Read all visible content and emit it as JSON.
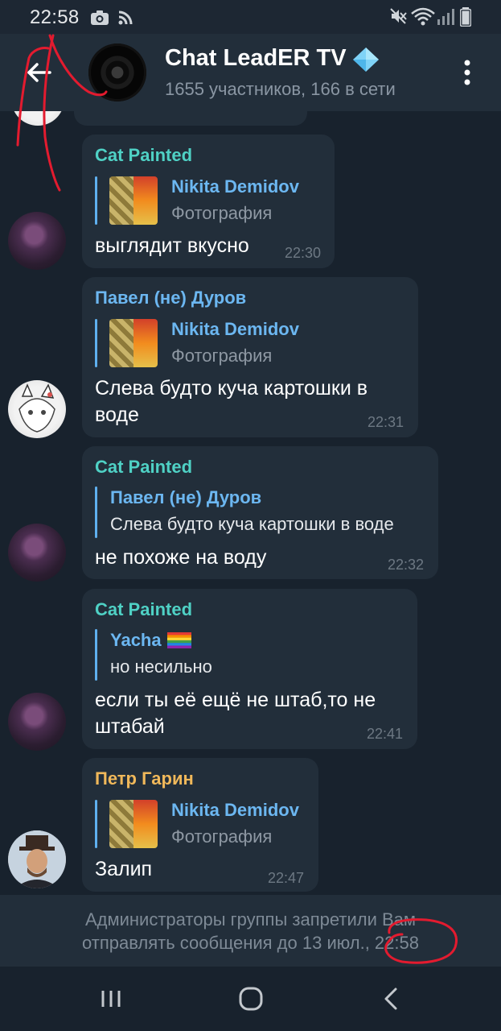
{
  "status_bar": {
    "time": "22:58"
  },
  "header": {
    "title": "Chat LeadER TV",
    "subtitle": "1655 участников, 166 в сети"
  },
  "messages": [
    {
      "sender": "Cat Painted",
      "sender_color": "#4fd1c5",
      "reply_author": "Nikita Demidov",
      "reply_text": "Фотография",
      "text": "выглядит вкусно",
      "time": "22:30"
    },
    {
      "sender": "Павел (не) Дуров",
      "sender_color": "#6cb7f1",
      "reply_author": "Nikita Demidov",
      "reply_text": "Фотография",
      "text_lines": [
        "Слева будто куча картошки в",
        "воде"
      ],
      "time": "22:31"
    },
    {
      "sender": "Cat Painted",
      "sender_color": "#4fd1c5",
      "reply_author": "Павел (не) Дуров",
      "reply_text": "Слева будто куча картошки в воде",
      "text": "не похоже на воду",
      "time": "22:32"
    },
    {
      "sender": "Cat Painted",
      "sender_color": "#4fd1c5",
      "reply_author": "Yacha",
      "reply_text": "но несильно",
      "text_lines": [
        "если ты её ещё не штаб,то не",
        "штабай"
      ],
      "time": "22:41"
    },
    {
      "sender": "Петр Гарин",
      "sender_color": "#f0b85a",
      "reply_author": "Nikita Demidov",
      "reply_text": "Фотография",
      "text": "Залип",
      "time": "22:47"
    }
  ],
  "banner": {
    "line1": "Администраторы группы запретили Вам",
    "line2": "отправлять сообщения до 13 июл., 22:58"
  }
}
